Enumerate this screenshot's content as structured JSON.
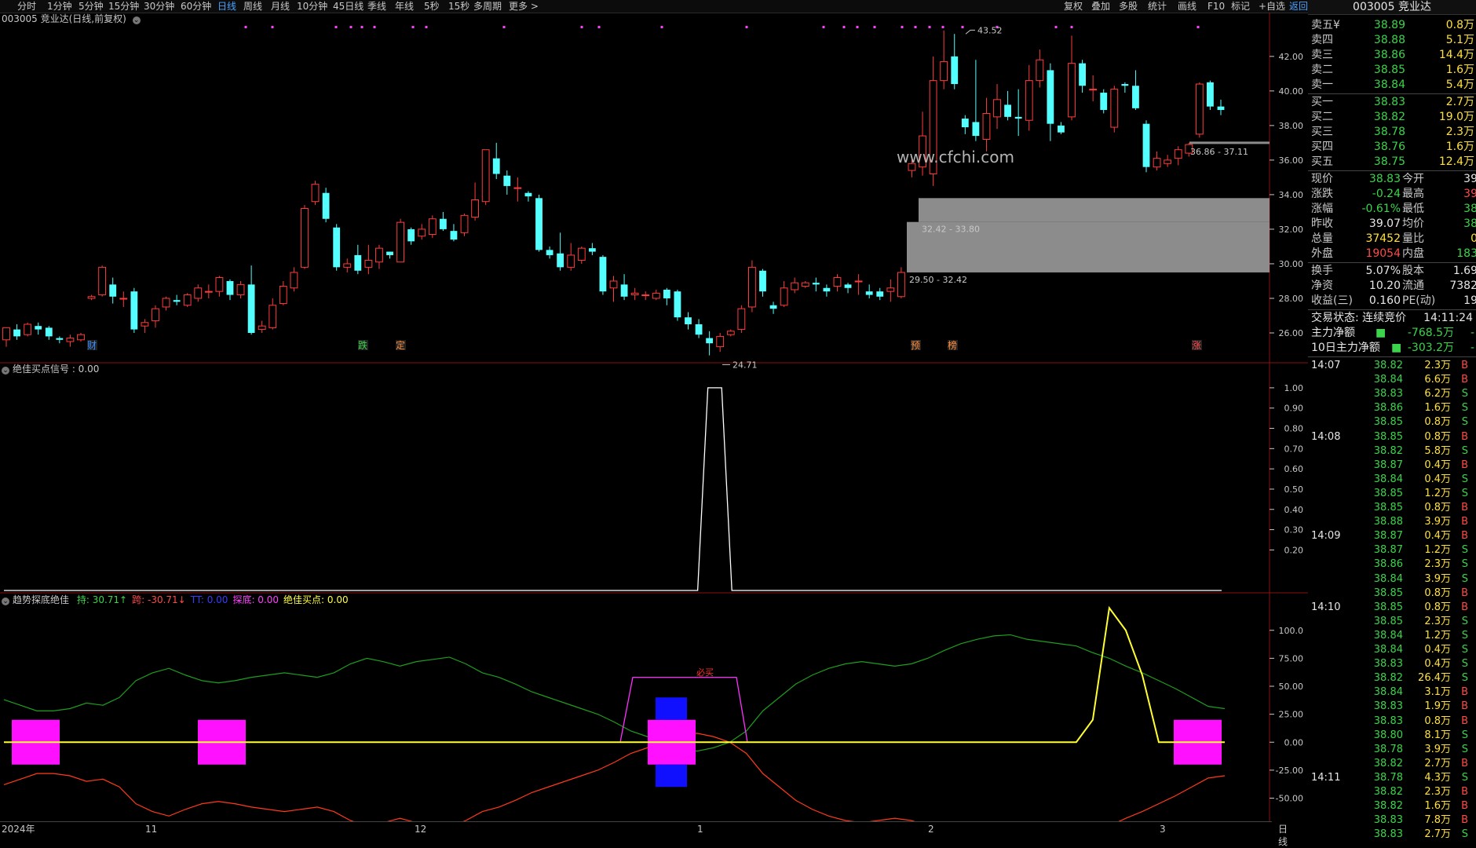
{
  "toolbar": {
    "periods": [
      "分时",
      "1分钟",
      "5分钟",
      "15分钟",
      "30分钟",
      "60分钟",
      "日线",
      "周线",
      "月线",
      "10分钟",
      "45日线",
      "季线",
      "年线",
      "5秒",
      "15秒",
      "多周期",
      "更多 >"
    ],
    "active_period": "日线",
    "right_buttons": [
      "复权",
      "叠加",
      "多股",
      "统计",
      "画线",
      "F10",
      "标记",
      "+自选",
      "返回"
    ],
    "active_right": "返回"
  },
  "stock_header": "003005 竞业达",
  "main_panel": {
    "title": "003005 竞业达(日线,前复权)",
    "high_label": "43.52",
    "low_label": "24.71",
    "box_labels": [
      "36.86 - 37.11",
      "32.42 - 33.80",
      "29.50 - 32.42"
    ],
    "watermark": "www.cfchi.com",
    "event_tags": [
      {
        "text": "财",
        "color": "#3a8cff"
      },
      {
        "text": "跌",
        "color": "#3bd44a"
      },
      {
        "text": "定",
        "color": "#ff8c3a"
      },
      {
        "text": "预",
        "color": "#ff8c3a"
      },
      {
        "text": "榜",
        "color": "#ff8c3a"
      },
      {
        "text": "涨",
        "color": "#ff4a4a"
      }
    ],
    "y_ticks": [
      "42.00",
      "40.00",
      "38.00",
      "36.00",
      "34.00",
      "32.00",
      "30.00",
      "28.00",
      "26.00"
    ]
  },
  "signal_panel": {
    "title": "绝佳买点信号 : 0.00",
    "y_ticks": [
      "1.00",
      "0.90",
      "0.80",
      "0.70",
      "0.60",
      "0.50",
      "0.40",
      "0.30",
      "0.20"
    ]
  },
  "trend_panel": {
    "title": "趋势探底绝佳",
    "legend": [
      {
        "text": "持: 30.71",
        "arrow": "↑",
        "color": "#3bd44a"
      },
      {
        "text": "跨: -30.71",
        "arrow": "↓",
        "color": "#ff4a4a"
      },
      {
        "text": "TT: 0.00",
        "color": "#3a3aff"
      },
      {
        "text": "探底: 0.00",
        "color": "#ff40ff"
      },
      {
        "text": "绝佳买点: 0.00",
        "color": "#ffff40"
      }
    ],
    "annotation": "必买",
    "y_ticks": [
      "100.0",
      "75.00",
      "50.00",
      "25.00",
      "0.00",
      "-25.00",
      "-50.00"
    ]
  },
  "date_axis": {
    "labels": [
      "2024年",
      "11",
      "12",
      "1",
      "2",
      "3"
    ],
    "right_label": "日线"
  },
  "quote": {
    "asks": [
      {
        "label": "卖五",
        "price": "38.89",
        "vol": "0.8万"
      },
      {
        "label": "卖四",
        "price": "38.88",
        "vol": "5.1万"
      },
      {
        "label": "卖三",
        "price": "38.86",
        "vol": "14.4万"
      },
      {
        "label": "卖二",
        "price": "38.85",
        "vol": "1.6万"
      },
      {
        "label": "卖一",
        "price": "38.84",
        "vol": "5.4万"
      }
    ],
    "ask_currency": "¥",
    "bids": [
      {
        "label": "买一",
        "price": "38.83",
        "vol": "2.7万"
      },
      {
        "label": "买二",
        "price": "38.82",
        "vol": "19.0万"
      },
      {
        "label": "买三",
        "price": "38.78",
        "vol": "2.3万"
      },
      {
        "label": "买四",
        "price": "38.76",
        "vol": "1.6万"
      },
      {
        "label": "买五",
        "price": "38.75",
        "vol": "12.4万"
      }
    ],
    "stats": [
      {
        "l1": "现价",
        "v1": "38.83",
        "c1": "green",
        "l2": "今开",
        "v2": "39",
        "c2": "white"
      },
      {
        "l1": "涨跌",
        "v1": "-0.24",
        "c1": "green",
        "l2": "最高",
        "v2": "39",
        "c2": "red"
      },
      {
        "l1": "涨幅",
        "v1": "-0.61%",
        "c1": "green",
        "l2": "最低",
        "v2": "38",
        "c2": "green"
      },
      {
        "l1": "昨收",
        "v1": "39.07",
        "c1": "white",
        "l2": "均价",
        "v2": "38",
        "c2": "green"
      },
      {
        "l1": "总量",
        "v1": "37452",
        "c1": "yellow",
        "l2": "量比",
        "v2": "0",
        "c2": "yellow"
      },
      {
        "l1": "外盘",
        "v1": "19054",
        "c1": "red",
        "l2": "内盘",
        "v2": "183",
        "c2": "green"
      }
    ],
    "stats2": [
      {
        "l1": "换手",
        "v1": "5.07%",
        "l2": "股本",
        "v2": "1.69"
      },
      {
        "l1": "净资",
        "v1": "10.20",
        "l2": "流通",
        "v2": "7382"
      },
      {
        "l1": "收益(三)",
        "v1": "0.160",
        "l2": "PE(动)",
        "v2": "19"
      }
    ],
    "trade_status": "交易状态: 连续竞价",
    "trade_time": "14:11:24",
    "flows": [
      {
        "label": "主力净额",
        "value": "-768.5万",
        "extra": "-"
      },
      {
        "label": "10日主力净额",
        "value": "-303.2万",
        "extra": "-"
      }
    ],
    "ticks": [
      {
        "time": "14:07",
        "price": "38.82",
        "vol": "2.3万",
        "side": "B"
      },
      {
        "time": "",
        "price": "38.84",
        "vol": "6.6万",
        "side": "B"
      },
      {
        "time": "",
        "price": "38.83",
        "vol": "6.2万",
        "side": "S"
      },
      {
        "time": "",
        "price": "38.86",
        "vol": "1.6万",
        "side": "S"
      },
      {
        "time": "",
        "price": "38.85",
        "vol": "0.8万",
        "side": "S"
      },
      {
        "time": "14:08",
        "price": "38.85",
        "vol": "0.8万",
        "side": "B"
      },
      {
        "time": "",
        "price": "38.82",
        "vol": "5.8万",
        "side": "S"
      },
      {
        "time": "",
        "price": "38.87",
        "vol": "0.4万",
        "side": "B"
      },
      {
        "time": "",
        "price": "38.84",
        "vol": "0.4万",
        "side": "S"
      },
      {
        "time": "",
        "price": "38.85",
        "vol": "1.2万",
        "side": "S"
      },
      {
        "time": "",
        "price": "38.85",
        "vol": "0.8万",
        "side": "B"
      },
      {
        "time": "",
        "price": "38.88",
        "vol": "3.9万",
        "side": "B"
      },
      {
        "time": "14:09",
        "price": "38.87",
        "vol": "0.4万",
        "side": "B"
      },
      {
        "time": "",
        "price": "38.87",
        "vol": "1.2万",
        "side": "S"
      },
      {
        "time": "",
        "price": "38.86",
        "vol": "2.3万",
        "side": "S"
      },
      {
        "time": "",
        "price": "38.84",
        "vol": "3.9万",
        "side": "S"
      },
      {
        "time": "",
        "price": "38.85",
        "vol": "0.8万",
        "side": "B"
      },
      {
        "time": "14:10",
        "price": "38.85",
        "vol": "0.8万",
        "side": "B"
      },
      {
        "time": "",
        "price": "38.85",
        "vol": "2.3万",
        "side": "S"
      },
      {
        "time": "",
        "price": "38.84",
        "vol": "1.2万",
        "side": "S"
      },
      {
        "time": "",
        "price": "38.84",
        "vol": "0.4万",
        "side": "S"
      },
      {
        "time": "",
        "price": "38.83",
        "vol": "0.4万",
        "side": "S"
      },
      {
        "time": "",
        "price": "38.82",
        "vol": "26.4万",
        "side": "S"
      },
      {
        "time": "",
        "price": "38.84",
        "vol": "3.1万",
        "side": "B"
      },
      {
        "time": "",
        "price": "38.83",
        "vol": "1.9万",
        "side": "B"
      },
      {
        "time": "",
        "price": "38.83",
        "vol": "0.8万",
        "side": "B"
      },
      {
        "time": "",
        "price": "38.80",
        "vol": "8.1万",
        "side": "S"
      },
      {
        "time": "",
        "price": "38.78",
        "vol": "3.9万",
        "side": "S"
      },
      {
        "time": "",
        "price": "38.82",
        "vol": "2.7万",
        "side": "B"
      },
      {
        "time": "14:11",
        "price": "38.78",
        "vol": "4.3万",
        "side": "S"
      },
      {
        "time": "",
        "price": "38.82",
        "vol": "2.3万",
        "side": "B"
      },
      {
        "time": "",
        "price": "38.82",
        "vol": "1.6万",
        "side": "B"
      },
      {
        "time": "",
        "price": "38.83",
        "vol": "7.8万",
        "side": "B"
      },
      {
        "time": "",
        "price": "38.83",
        "vol": "2.7万",
        "side": "S"
      }
    ]
  },
  "chart_data": {
    "type": "candlestick",
    "candles": [
      [
        25.6,
        26.3,
        25.2,
        26.1
      ],
      [
        26.2,
        25.8,
        25.6,
        26.5
      ],
      [
        25.9,
        26.5,
        25.8,
        26.6
      ],
      [
        26.4,
        26.2,
        25.9,
        26.6
      ],
      [
        26.3,
        25.8,
        25.6,
        26.4
      ],
      [
        25.7,
        25.6,
        25.4,
        25.8
      ],
      [
        25.5,
        25.7,
        25.2,
        25.9
      ],
      [
        25.6,
        25.9,
        25.5,
        26.0
      ],
      [
        28.0,
        28.1,
        27.9,
        28.2
      ],
      [
        28.2,
        29.8,
        28.1,
        29.9
      ],
      [
        28.8,
        28.1,
        27.7,
        29.2
      ],
      [
        28.0,
        28.0,
        27.5,
        28.4
      ],
      [
        28.4,
        26.2,
        26.0,
        28.6
      ],
      [
        26.4,
        26.6,
        26.0,
        26.8
      ],
      [
        26.7,
        27.4,
        26.3,
        27.6
      ],
      [
        27.5,
        28.0,
        27.3,
        28.1
      ],
      [
        27.9,
        27.8,
        27.6,
        28.2
      ],
      [
        27.6,
        28.2,
        27.5,
        28.3
      ],
      [
        28.0,
        28.6,
        27.8,
        28.8
      ],
      [
        28.4,
        28.4,
        28.0,
        28.8
      ],
      [
        28.4,
        29.2,
        28.1,
        29.3
      ],
      [
        29.0,
        28.2,
        27.9,
        29.1
      ],
      [
        28.2,
        28.8,
        28.0,
        29.0
      ],
      [
        28.8,
        26.0,
        25.9,
        29.9
      ],
      [
        26.2,
        26.4,
        26.0,
        26.7
      ],
      [
        26.3,
        27.6,
        26.2,
        28.0
      ],
      [
        27.7,
        28.7,
        27.6,
        29.0
      ],
      [
        28.6,
        29.5,
        28.4,
        29.8
      ],
      [
        29.8,
        33.2,
        29.7,
        33.4
      ],
      [
        33.6,
        34.6,
        33.4,
        34.8
      ],
      [
        34.1,
        32.6,
        32.4,
        34.4
      ],
      [
        32.1,
        29.8,
        29.6,
        32.3
      ],
      [
        29.8,
        30.0,
        29.5,
        30.3
      ],
      [
        30.5,
        29.6,
        29.4,
        31.1
      ],
      [
        29.8,
        30.2,
        29.4,
        31.1
      ],
      [
        30.1,
        30.9,
        29.7,
        31.1
      ],
      [
        30.7,
        30.5,
        30.3,
        30.7
      ],
      [
        30.1,
        32.4,
        30.1,
        32.6
      ],
      [
        32.0,
        31.3,
        31.1,
        32.1
      ],
      [
        31.6,
        32.0,
        31.4,
        32.3
      ],
      [
        31.7,
        32.6,
        31.5,
        32.8
      ],
      [
        32.6,
        32.0,
        31.9,
        33.0
      ],
      [
        31.9,
        31.4,
        31.3,
        32.3
      ],
      [
        31.8,
        32.8,
        31.6,
        32.9
      ],
      [
        32.7,
        33.7,
        32.5,
        34.7
      ],
      [
        33.6,
        36.6,
        33.4,
        36.6
      ],
      [
        36.1,
        35.2,
        34.9,
        37.0
      ],
      [
        35.1,
        34.5,
        34.0,
        35.4
      ],
      [
        34.4,
        34.4,
        33.6,
        35.0
      ],
      [
        34.1,
        33.9,
        33.6,
        34.2
      ],
      [
        33.8,
        30.8,
        30.7,
        34.0
      ],
      [
        30.8,
        30.5,
        30.3,
        31.0
      ],
      [
        30.6,
        29.8,
        29.6,
        31.8
      ],
      [
        29.8,
        30.5,
        29.6,
        31.2
      ],
      [
        30.2,
        30.9,
        30.0,
        31.0
      ],
      [
        30.9,
        30.7,
        30.5,
        31.2
      ],
      [
        30.4,
        28.4,
        28.2,
        30.5
      ],
      [
        28.6,
        29.0,
        27.8,
        29.3
      ],
      [
        28.8,
        28.1,
        27.9,
        29.4
      ],
      [
        28.2,
        28.3,
        27.9,
        28.6
      ],
      [
        28.2,
        28.2,
        27.9,
        28.4
      ],
      [
        28.0,
        28.3,
        27.9,
        28.5
      ],
      [
        28.5,
        28.0,
        27.6,
        28.6
      ],
      [
        28.4,
        26.9,
        26.7,
        28.5
      ],
      [
        26.9,
        26.5,
        26.2,
        27.2
      ],
      [
        26.5,
        25.9,
        25.7,
        26.8
      ],
      [
        25.7,
        25.4,
        24.7,
        26.1
      ],
      [
        25.2,
        25.8,
        24.9,
        26.0
      ],
      [
        25.9,
        26.1,
        25.8,
        26.2
      ],
      [
        26.2,
        27.4,
        26.0,
        27.6
      ],
      [
        27.5,
        29.8,
        27.2,
        30.2
      ],
      [
        29.6,
        28.4,
        28.1,
        29.7
      ],
      [
        27.6,
        27.4,
        27.1,
        27.8
      ],
      [
        27.6,
        28.6,
        27.5,
        29.0
      ],
      [
        28.5,
        28.9,
        28.3,
        29.2
      ],
      [
        28.7,
        28.9,
        28.6,
        29.0
      ],
      [
        28.9,
        28.8,
        28.4,
        29.2
      ],
      [
        28.6,
        28.4,
        28.1,
        28.8
      ],
      [
        28.7,
        29.2,
        28.4,
        29.4
      ],
      [
        28.8,
        28.6,
        28.3,
        28.9
      ],
      [
        29.0,
        29.0,
        28.2,
        29.4
      ],
      [
        28.4,
        28.2,
        28.0,
        28.8
      ],
      [
        28.4,
        28.1,
        27.9,
        28.6
      ],
      [
        28.4,
        28.6,
        27.8,
        29.1
      ],
      [
        28.1,
        29.5,
        28.0,
        29.8
      ],
      [
        35.4,
        35.8,
        35.0,
        36.2
      ],
      [
        35.6,
        37.4,
        35.1,
        38.8
      ],
      [
        35.2,
        40.6,
        34.5,
        42.0
      ],
      [
        40.6,
        41.7,
        40.1,
        43.5
      ],
      [
        42.0,
        40.4,
        40.1,
        43.3
      ],
      [
        38.4,
        37.9,
        37.5,
        38.6
      ],
      [
        38.2,
        37.4,
        37.1,
        41.8
      ],
      [
        37.2,
        38.7,
        36.5,
        39.6
      ],
      [
        38.5,
        39.5,
        37.8,
        40.4
      ],
      [
        39.2,
        38.5,
        38.3,
        40.0
      ],
      [
        38.5,
        38.4,
        37.4,
        40.1
      ],
      [
        38.3,
        40.6,
        37.7,
        41.5
      ],
      [
        40.6,
        41.8,
        40.2,
        42.4
      ],
      [
        41.2,
        38.1,
        37.1,
        41.6
      ],
      [
        38.0,
        37.6,
        37.5,
        38.2
      ],
      [
        38.5,
        41.6,
        38.3,
        43.2
      ],
      [
        41.6,
        40.3,
        39.9,
        41.8
      ],
      [
        40.1,
        40.1,
        39.4,
        40.9
      ],
      [
        39.9,
        38.9,
        38.7,
        40.1
      ],
      [
        37.9,
        40.1,
        37.6,
        40.3
      ],
      [
        40.4,
        40.3,
        39.9,
        40.5
      ],
      [
        40.3,
        39.0,
        38.9,
        41.2
      ],
      [
        38.1,
        35.6,
        35.3,
        38.3
      ],
      [
        35.6,
        36.1,
        35.4,
        36.5
      ],
      [
        35.8,
        36.0,
        35.6,
        36.3
      ],
      [
        36.1,
        36.6,
        35.7,
        36.8
      ],
      [
        36.4,
        36.9,
        36.2,
        37.0
      ],
      [
        37.5,
        40.4,
        37.3,
        40.5
      ],
      [
        40.5,
        39.1,
        38.9,
        40.6
      ],
      [
        39.1,
        38.9,
        38.6,
        39.5
      ]
    ],
    "ylim": [
      25,
      43.9
    ],
    "signal": {
      "ylim": [
        0,
        1.05
      ],
      "peak_index": [
        66,
        67
      ],
      "values": "0 except 1.00 near 24.71 low"
    },
    "trend": {
      "ylim": [
        -70,
        130
      ],
      "hold_series": [
        38,
        33,
        28,
        28,
        30,
        35,
        33,
        40,
        55,
        62,
        66,
        60,
        55,
        53,
        55,
        58,
        60,
        62,
        60,
        58,
        62,
        70,
        75,
        72,
        68,
        72,
        74,
        76,
        70,
        62,
        58,
        52,
        45,
        40,
        35,
        30,
        25,
        18,
        10,
        5,
        0,
        -5,
        -8,
        -5,
        0,
        10,
        28,
        40,
        52,
        60,
        66,
        70,
        72,
        70,
        68,
        70,
        75,
        82,
        88,
        92,
        95,
        96,
        92,
        90,
        88,
        86,
        80,
        75,
        68,
        62,
        55,
        48,
        40,
        32,
        30
      ],
      "cross_series": [
        -38,
        -33,
        -28,
        -28,
        -30,
        -35,
        -33,
        -40,
        -55,
        -62,
        -66,
        -60,
        -55,
        -53,
        -55,
        -58,
        -60,
        -62,
        -60,
        -58,
        -62,
        -70,
        -75,
        -72,
        -68,
        -72,
        -74,
        -76,
        -70,
        -62,
        -58,
        -52,
        -45,
        -40,
        -35,
        -30,
        -25,
        -18,
        -10,
        -5,
        0,
        5,
        8,
        5,
        0,
        -10,
        -28,
        -40,
        -52,
        -60,
        -66,
        -70,
        -72,
        -70,
        -68,
        -70,
        -75,
        -82,
        -88,
        -92,
        -95,
        -96,
        -92,
        -90,
        -88,
        -86,
        -80,
        -75,
        -68,
        -62,
        -55,
        -48,
        -40,
        -32,
        -30
      ],
      "buy_points": [
        0,
        0,
        0,
        0,
        0,
        0,
        0,
        0,
        0,
        0,
        0,
        0,
        0,
        0,
        0,
        0,
        0,
        0,
        0,
        0,
        0,
        0,
        0,
        0,
        0,
        0,
        0,
        0,
        0,
        0,
        0,
        0,
        0,
        0,
        0,
        0,
        0,
        0,
        0,
        0,
        0,
        0,
        0,
        0,
        0,
        0,
        0,
        0,
        0,
        0,
        0,
        0,
        0,
        0,
        0,
        0,
        0,
        0,
        0,
        0,
        0,
        0,
        0,
        0,
        0,
        0,
        20,
        120,
        100,
        60,
        0,
        0,
        0,
        0,
        0
      ]
    }
  }
}
